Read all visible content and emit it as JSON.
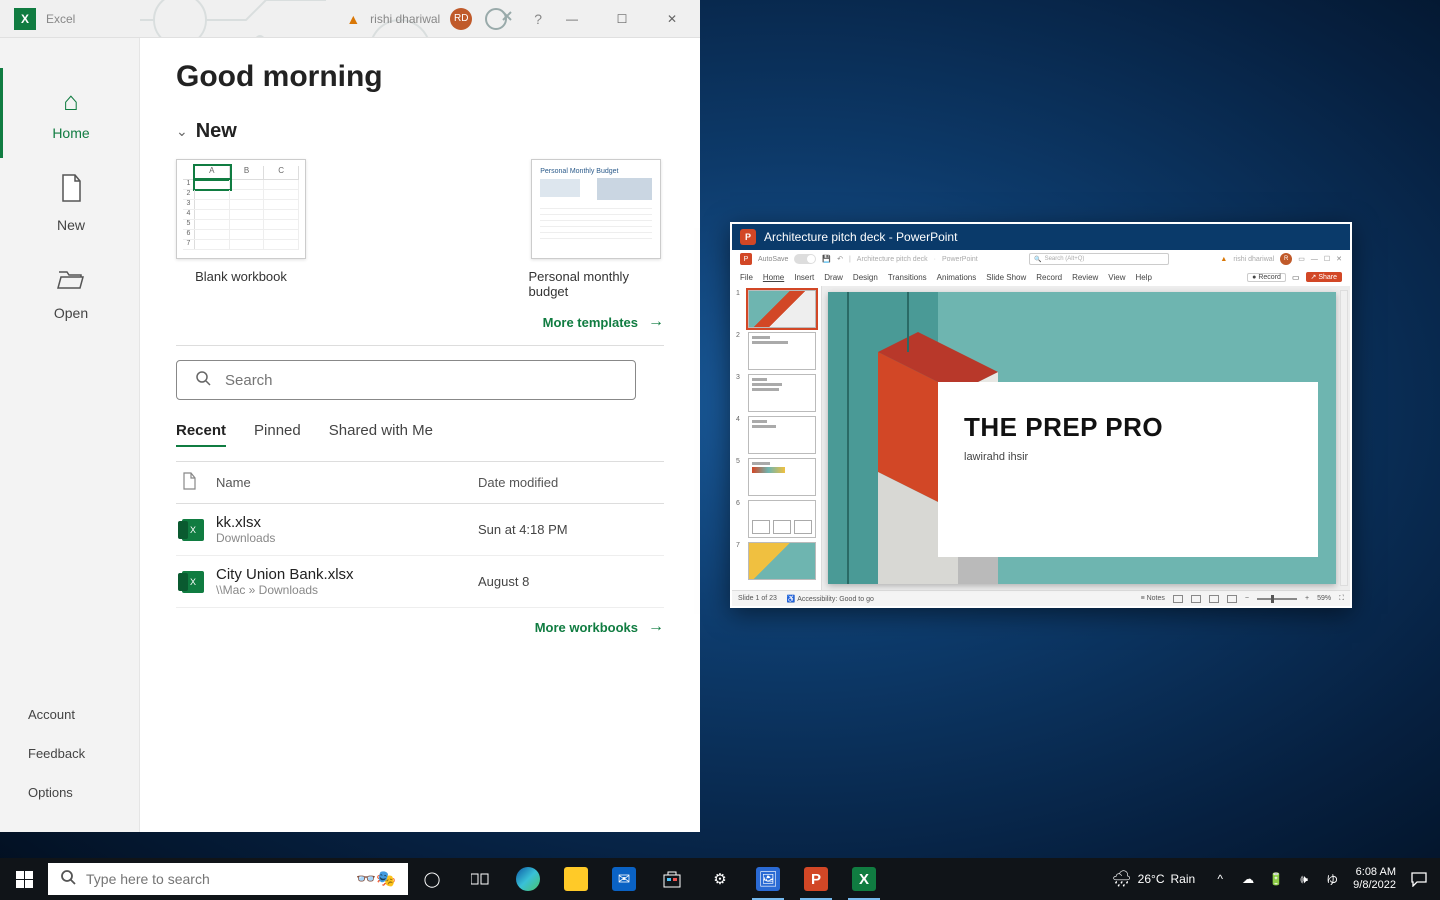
{
  "excel": {
    "app_name": "Excel",
    "user_name": "rishi dhariwal",
    "avatar_initials": "RD",
    "sidebar": {
      "home": "Home",
      "new": "New",
      "open": "Open",
      "account": "Account",
      "feedback": "Feedback",
      "options": "Options"
    },
    "greeting": "Good morning",
    "section_new": "New",
    "templates": {
      "blank": "Blank workbook",
      "budget": "Personal monthly budget",
      "budget_small": "Personal Monthly Budget"
    },
    "more_templates": "More templates",
    "search_placeholder": "Search",
    "tabs": {
      "recent": "Recent",
      "pinned": "Pinned",
      "shared": "Shared with Me"
    },
    "columns": {
      "name": "Name",
      "date": "Date modified"
    },
    "files": [
      {
        "name": "kk.xlsx",
        "path": "Downloads",
        "date": "Sun at 4:18 PM"
      },
      {
        "name": "City Union Bank.xlsx",
        "path": "\\\\Mac » Downloads",
        "date": "August 8"
      }
    ],
    "more_workbooks": "More workbooks"
  },
  "ppt": {
    "window_title": "Architecture pitch deck - PowerPoint",
    "autosave": "AutoSave",
    "doc_name": "Architecture pitch deck",
    "app_name": "PowerPoint",
    "search_hint": "Search (Alt+Q)",
    "user_name": "rishi dhariwal",
    "ribbon": [
      "File",
      "Home",
      "Insert",
      "Draw",
      "Design",
      "Transitions",
      "Animations",
      "Slide Show",
      "Record",
      "Review",
      "View",
      "Help"
    ],
    "record_btn": "Record",
    "share_btn": "Share",
    "slide": {
      "title": "THE PREP PRO",
      "subtitle": "lawirahd ihsir"
    },
    "status": {
      "slide": "Slide 1 of 23",
      "lang": "",
      "access": "Accessibility: Good to go",
      "notes": "Notes",
      "zoom": "59%"
    },
    "thumb_count": 7
  },
  "taskbar": {
    "search_placeholder": "Type here to search",
    "weather": {
      "temp": "26°C",
      "cond": "Rain"
    },
    "time": "6:08 AM",
    "date": "9/8/2022"
  }
}
